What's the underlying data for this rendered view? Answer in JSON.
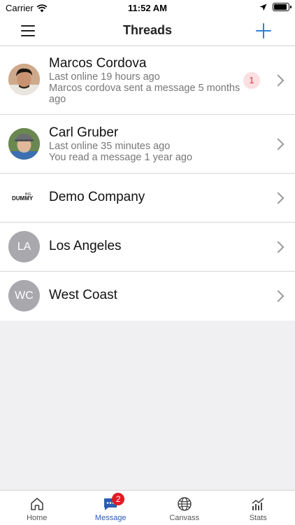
{
  "status_bar": {
    "carrier": "Carrier",
    "time": "11:52 AM"
  },
  "nav": {
    "title": "Threads"
  },
  "threads": [
    {
      "name": "Marcos Cordova",
      "line1": "Last online 19 hours ago",
      "line2": "Marcos cordova sent a message 5 months ago",
      "unread": "1",
      "avatar": "photo-man-dark-hair"
    },
    {
      "name": "Carl Gruber",
      "line1": "Last online 35 minutes ago",
      "line2": "You read a message 1 year ago",
      "avatar": "photo-man-cap"
    },
    {
      "name": "Demo Company",
      "avatar": "company-logo",
      "logo_top": "BIG",
      "logo_text": "DUMMY"
    },
    {
      "name": "Los Angeles",
      "initials": "LA"
    },
    {
      "name": "West Coast",
      "initials": "WC"
    }
  ],
  "tabs": [
    {
      "label": "Home",
      "icon": "home-icon"
    },
    {
      "label": "Message",
      "icon": "message-icon",
      "badge": "2",
      "active": true
    },
    {
      "label": "Canvass",
      "icon": "globe-icon"
    },
    {
      "label": "Stats",
      "icon": "stats-icon"
    }
  ],
  "colors": {
    "accent": "#2a83d8",
    "active_tab": "#2a5db0",
    "badge_red": "#e01b24",
    "unread_bg": "#fbdfe1",
    "avatar_gray": "#a8a8ad"
  }
}
